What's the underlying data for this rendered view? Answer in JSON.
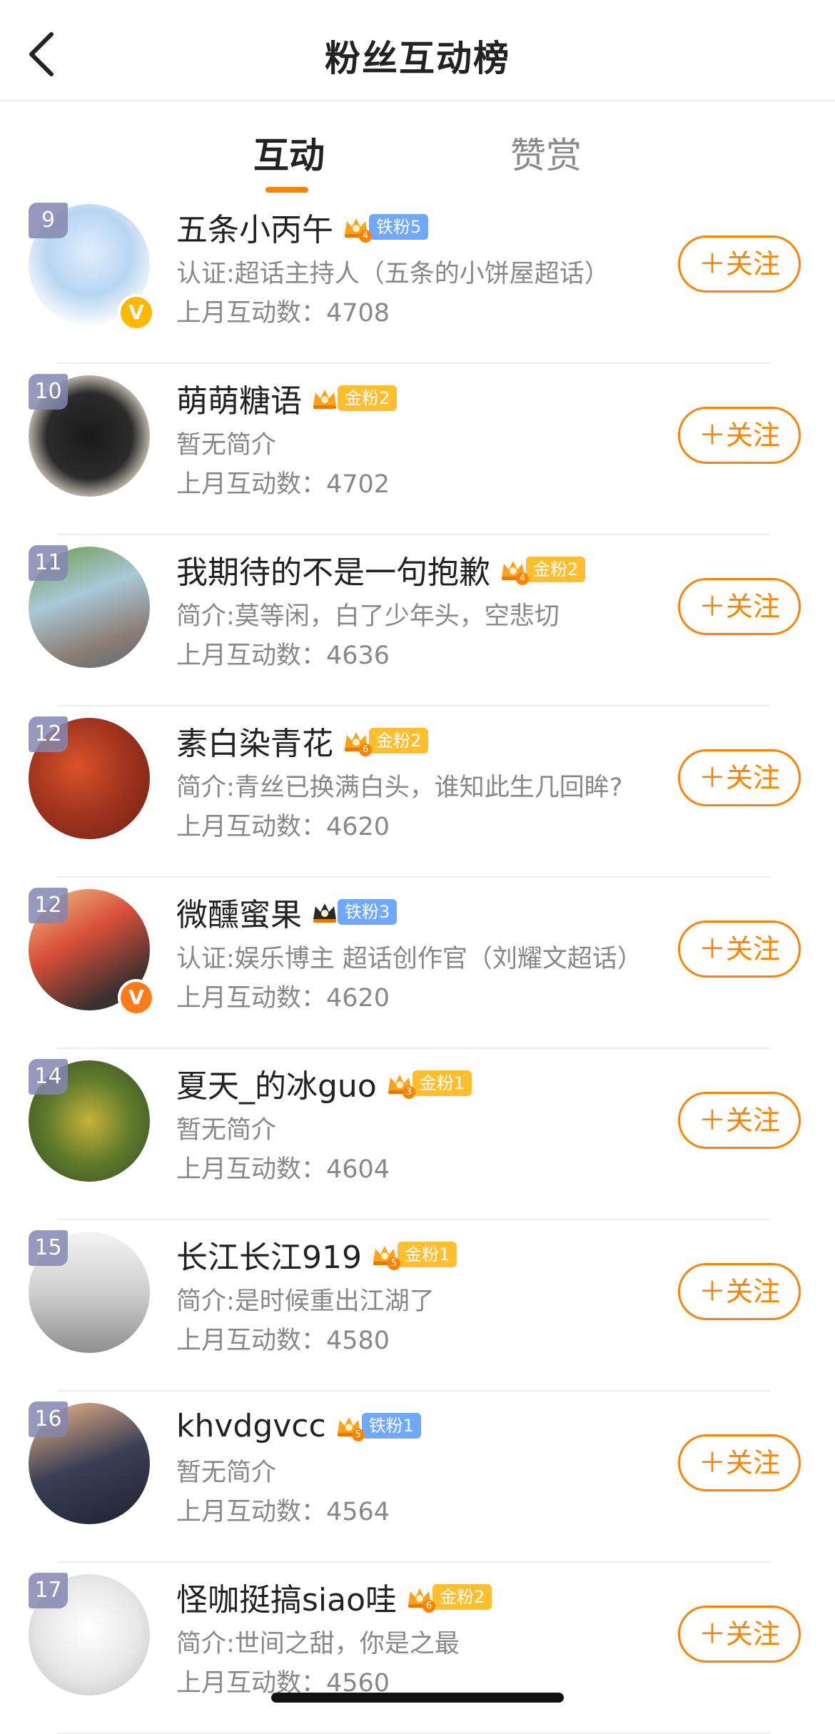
{
  "header": {
    "title": "粉丝互动榜",
    "back_icon": "chevron-left-icon"
  },
  "tabs": [
    {
      "label": "互动",
      "active": true
    },
    {
      "label": "赞赏",
      "active": false
    }
  ],
  "accent_color": "#ff8200",
  "follow_label": "＋关注",
  "users": [
    {
      "rank": "9",
      "name": "五条小丙午",
      "crown_level": "4",
      "fan_type": "iron",
      "fan_badge": "铁粉5",
      "desc": "认证:超话主持人（五条的小饼屋超话）",
      "count": "上月互动数：4708",
      "verified": "yellow"
    },
    {
      "rank": "10",
      "name": "萌萌糖语",
      "crown_level": "",
      "fan_type": "gold",
      "fan_badge": "金粉2",
      "desc": "暂无简介",
      "count": "上月互动数：4702",
      "verified": ""
    },
    {
      "rank": "11",
      "name": "我期待的不是一句抱歉",
      "crown_level": "4",
      "fan_type": "gold",
      "fan_badge": "金粉2",
      "desc": "简介:莫等闲，白了少年头，空悲切",
      "count": "上月互动数：4636",
      "verified": ""
    },
    {
      "rank": "12",
      "name": "素白染青花",
      "crown_level": "6",
      "fan_type": "gold",
      "fan_badge": "金粉2",
      "desc": "简介:青丝已换满白头，谁知此生几回眸?",
      "count": "上月互动数：4620",
      "verified": ""
    },
    {
      "rank": "12",
      "name": "微醺蜜果",
      "crown_level": "",
      "fan_type": "iron",
      "fan_badge": "铁粉3",
      "desc": "认证:娱乐博主 超话创作官（刘耀文超话）",
      "count": "上月互动数：4620",
      "verified": "orange"
    },
    {
      "rank": "14",
      "name": "夏天_的冰guo",
      "crown_level": "3",
      "fan_type": "gold",
      "fan_badge": "金粉1",
      "desc": "暂无简介",
      "count": "上月互动数：4604",
      "verified": ""
    },
    {
      "rank": "15",
      "name": "长江长江919",
      "crown_level": "5",
      "fan_type": "gold",
      "fan_badge": "金粉1",
      "desc": "简介:是时候重出江湖了",
      "count": "上月互动数：4580",
      "verified": ""
    },
    {
      "rank": "16",
      "name": "khvdgvcc",
      "crown_level": "5",
      "fan_type": "iron",
      "fan_badge": "铁粉1",
      "desc": "暂无简介",
      "count": "上月互动数：4564",
      "verified": ""
    },
    {
      "rank": "17",
      "name": "怪咖挺搞siao哇",
      "crown_level": "6",
      "fan_type": "gold",
      "fan_badge": "金粉2",
      "desc": "简介:世间之甜，你是之最",
      "count": "上月互动数：4560",
      "verified": ""
    }
  ]
}
